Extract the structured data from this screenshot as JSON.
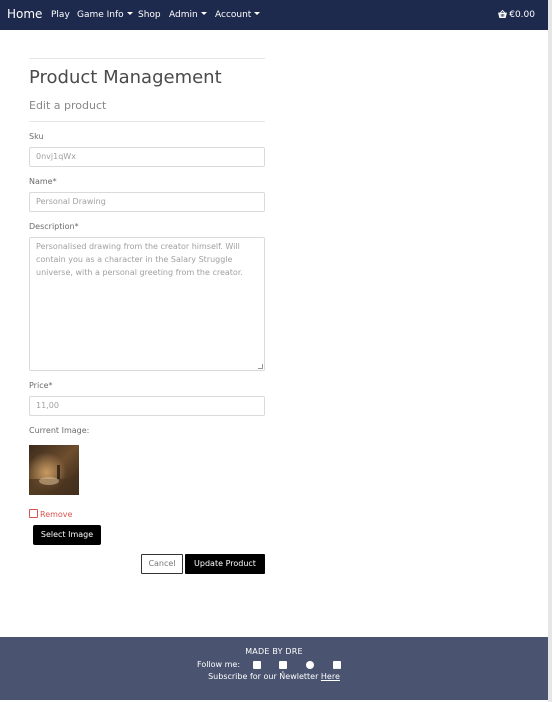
{
  "navbar": {
    "brand": "Home",
    "links": [
      {
        "label": "Play",
        "dropdown": false
      },
      {
        "label": "Game Info",
        "dropdown": true
      },
      {
        "label": "Shop",
        "dropdown": false
      },
      {
        "label": "Admin",
        "dropdown": true
      },
      {
        "label": "Account",
        "dropdown": true
      }
    ],
    "cart_total": "€0.00",
    "cart_icon": "shopping-basket-icon"
  },
  "page": {
    "title": "Product Management",
    "subtitle": "Edit a product"
  },
  "form": {
    "sku": {
      "label": "Sku",
      "value": "0nvj1qWx"
    },
    "name": {
      "label": "Name*",
      "value": "Personal Drawing"
    },
    "description": {
      "label": "Description*",
      "value": "Personalised drawing from the creator himself. Will contain you as a character in the Salary Struggle universe, with a personal greeting from the creator."
    },
    "price": {
      "label": "Price*",
      "value": "11,00"
    },
    "current_image": {
      "label": "Current Image:"
    },
    "remove": {
      "label": "Remove",
      "checked": false
    },
    "select_image_label": "Select Image",
    "cancel_label": "Cancel",
    "submit_label": "Update Product"
  },
  "footer": {
    "made_by": "MADE BY DRE",
    "follow": "Follow me:",
    "social_icons": [
      "facebook-icon",
      "youtube-icon",
      "github-icon",
      "instagram-icon"
    ],
    "newsletter_text": "Subscribe for our Newletter",
    "newsletter_link": "Here"
  },
  "colors": {
    "navbar_bg": "#1e2a4d",
    "footer_bg": "#4a5470",
    "button_bg": "#000000",
    "danger": "#d9534f"
  }
}
